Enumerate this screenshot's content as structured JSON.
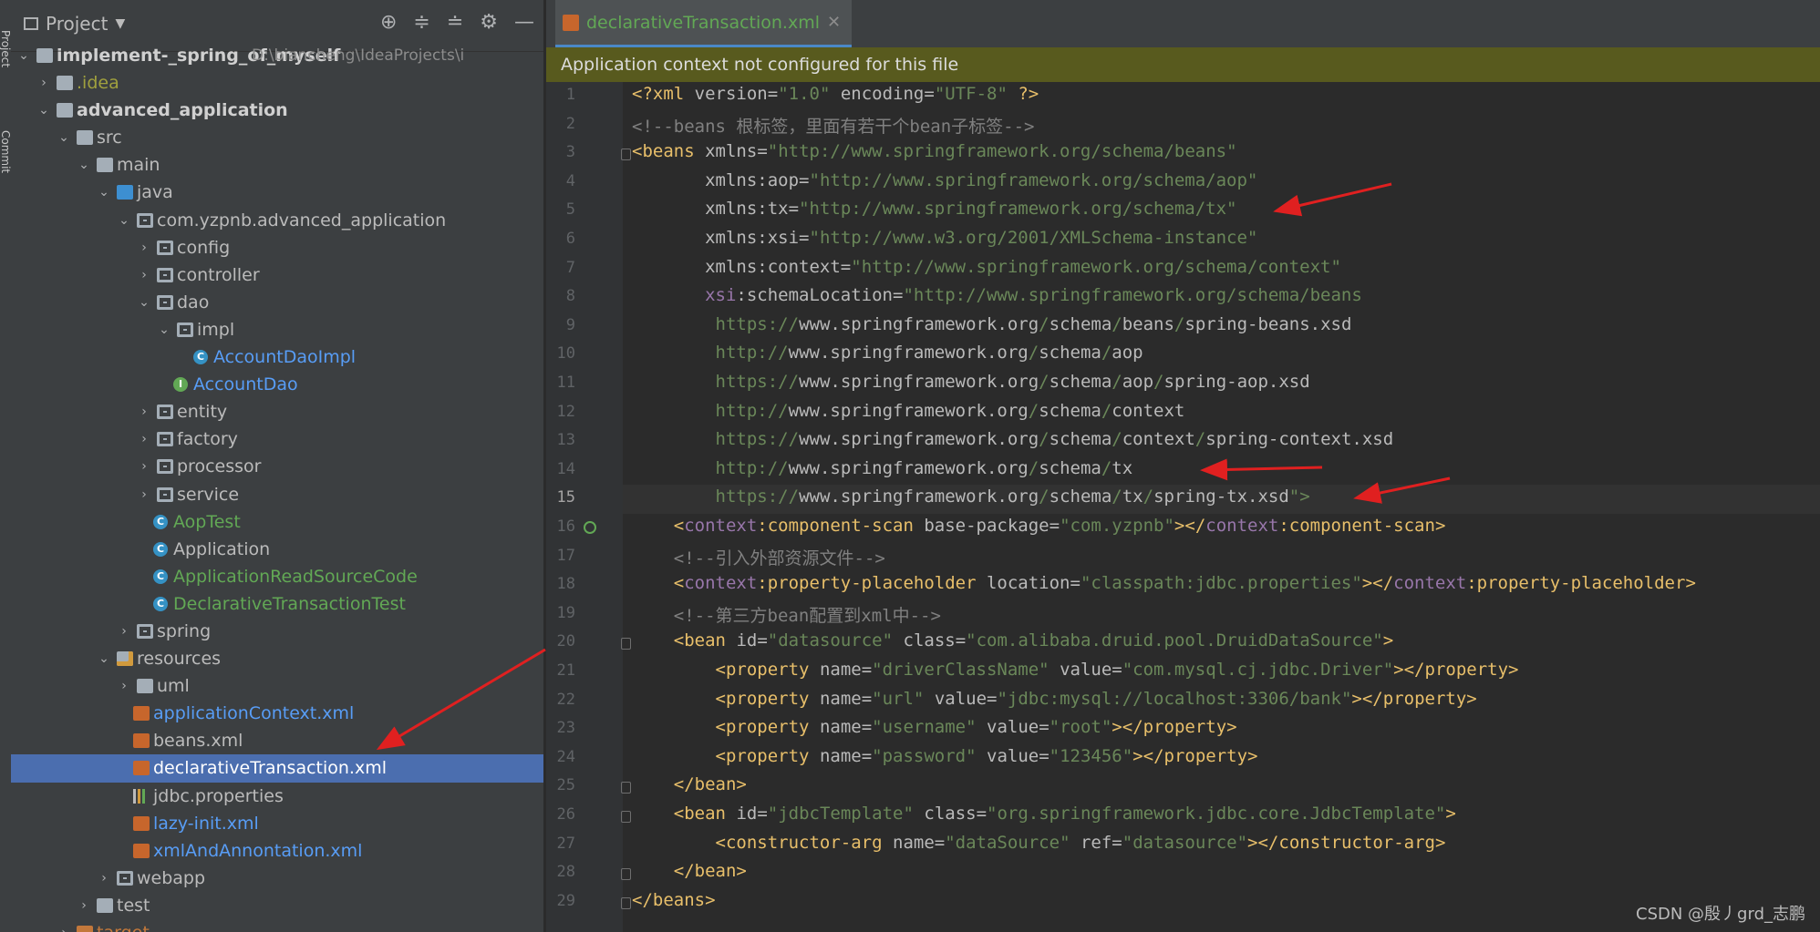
{
  "toolstrip": {
    "project": "Project",
    "commit": "Commit"
  },
  "project_panel": {
    "title": "Project",
    "tree": [
      {
        "label": "implement-_spring_of_myself",
        "path": "D:\\biancheng\\IdeaProjects\\i"
      },
      {
        "label": ".idea"
      },
      {
        "label": "advanced_application"
      },
      {
        "label": "src"
      },
      {
        "label": "main"
      },
      {
        "label": "java"
      },
      {
        "label": "com.yzpnb.advanced_application"
      },
      {
        "label": "config"
      },
      {
        "label": "controller"
      },
      {
        "label": "dao"
      },
      {
        "label": "impl"
      },
      {
        "label": "AccountDaoImpl"
      },
      {
        "label": "AccountDao"
      },
      {
        "label": "entity"
      },
      {
        "label": "factory"
      },
      {
        "label": "processor"
      },
      {
        "label": "service"
      },
      {
        "label": "AopTest"
      },
      {
        "label": "Application"
      },
      {
        "label": "ApplicationReadSourceCode"
      },
      {
        "label": "DeclarativeTransactionTest"
      },
      {
        "label": "spring"
      },
      {
        "label": "resources"
      },
      {
        "label": "uml"
      },
      {
        "label": "applicationContext.xml"
      },
      {
        "label": "beans.xml"
      },
      {
        "label": "declarativeTransaction.xml"
      },
      {
        "label": "jdbc.properties"
      },
      {
        "label": "lazy-init.xml"
      },
      {
        "label": "xmlAndAnnontation.xml"
      },
      {
        "label": "webapp"
      },
      {
        "label": "test"
      },
      {
        "label": "target"
      }
    ]
  },
  "editor": {
    "tab_name": "declarativeTransaction.xml",
    "banner": "Application context not configured for this file",
    "line_numbers": [
      "1",
      "2",
      "3",
      "4",
      "5",
      "6",
      "7",
      "8",
      "9",
      "10",
      "11",
      "12",
      "13",
      "14",
      "15",
      "16",
      "17",
      "18",
      "19",
      "20",
      "21",
      "22",
      "23",
      "24",
      "25",
      "26",
      "27",
      "28",
      "29"
    ],
    "lines": [
      "<?xml version=\"1.0\" encoding=\"UTF-8\" ?>",
      "<!--beans 根标签，里面有若干个bean子标签-->",
      "<beans xmlns=\"http://www.springframework.org/schema/beans\"",
      "       xmlns:aop=\"http://www.springframework.org/schema/aop\"",
      "       xmlns:tx=\"http://www.springframework.org/schema/tx\"",
      "       xmlns:xsi=\"http://www.w3.org/2001/XMLSchema-instance\"",
      "       xmlns:context=\"http://www.springframework.org/schema/context\"",
      "       xsi:schemaLocation=\"http://www.springframework.org/schema/beans",
      "        https://www.springframework.org/schema/beans/spring-beans.xsd",
      "        http://www.springframework.org/schema/aop",
      "        https://www.springframework.org/schema/aop/spring-aop.xsd",
      "        http://www.springframework.org/schema/context",
      "        https://www.springframework.org/schema/context/spring-context.xsd",
      "        http://www.springframework.org/schema/tx",
      "        https://www.springframework.org/schema/tx/spring-tx.xsd\">",
      "    <context:component-scan base-package=\"com.yzpnb\"></context:component-scan>",
      "    <!--引入外部资源文件-->",
      "    <context:property-placeholder location=\"classpath:jdbc.properties\"></context:property-placeholder>",
      "    <!--第三方bean配置到xml中-->",
      "    <bean id=\"datasource\" class=\"com.alibaba.druid.pool.DruidDataSource\">",
      "        <property name=\"driverClassName\" value=\"com.mysql.cj.jdbc.Driver\"></property>",
      "        <property name=\"url\" value=\"jdbc:mysql://localhost:3306/bank\"></property>",
      "        <property name=\"username\" value=\"root\"></property>",
      "        <property name=\"password\" value=\"123456\"></property>",
      "    </bean>",
      "    <bean id=\"jdbcTemplate\" class=\"org.springframework.jdbc.core.JdbcTemplate\">",
      "        <constructor-arg name=\"dataSource\" ref=\"datasource\"></constructor-arg>",
      "    </bean>",
      "</beans>"
    ]
  },
  "watermark": "CSDN @殷丿grd_志鹏",
  "colors": {
    "selection": "#4b6eaf",
    "banner": "#585a1e",
    "arrow": "#e02020"
  }
}
